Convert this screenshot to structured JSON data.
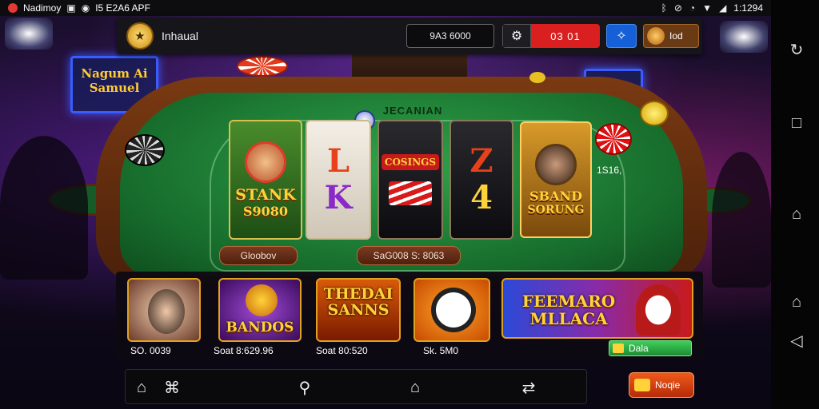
{
  "status_bar": {
    "app_label": "Nadimoy",
    "notif_text": "I5 E2A6 APF",
    "time": "1:1294"
  },
  "app_bar": {
    "title": "Inhaual",
    "balance": "9A3 6000",
    "timer": "03 01",
    "profile_label": "Iod"
  },
  "table": {
    "title": "JECANIAN",
    "cards": [
      {
        "line1": "STANK",
        "line2": "S9080"
      },
      {
        "top": "L",
        "bottom": "K"
      },
      {
        "top": "COSINGS",
        "bottom": ""
      },
      {
        "top": "Z",
        "bottom": "4"
      },
      {
        "line1": "SBAND",
        "line2": "SORUNG"
      }
    ],
    "side_label": "1S16,",
    "left_button": "Gloobov",
    "center_button": "SaG008 S: 8063"
  },
  "signs": {
    "left": "Nagum Ai Samuel"
  },
  "games": [
    {
      "name": "",
      "caption": "SO. 0039"
    },
    {
      "name": "BANDOS",
      "caption": "Soat 8:629.96"
    },
    {
      "name": "THEDAI SANNS",
      "caption": "Soat 80:520"
    },
    {
      "name": "",
      "caption": "Sk. 5M0"
    },
    {
      "name": "FEEMARO MLLACA",
      "caption": ""
    }
  ],
  "play_button": "Dala",
  "bottom_cta": "Noqie",
  "icons": {
    "home": "home-icon",
    "search": "search-icon",
    "swap": "swap-icon"
  },
  "colors": {
    "felt": "#1f8a3a",
    "accent_red": "#d91f1f",
    "accent_blue": "#1560d6",
    "gold": "#ffd23a"
  }
}
